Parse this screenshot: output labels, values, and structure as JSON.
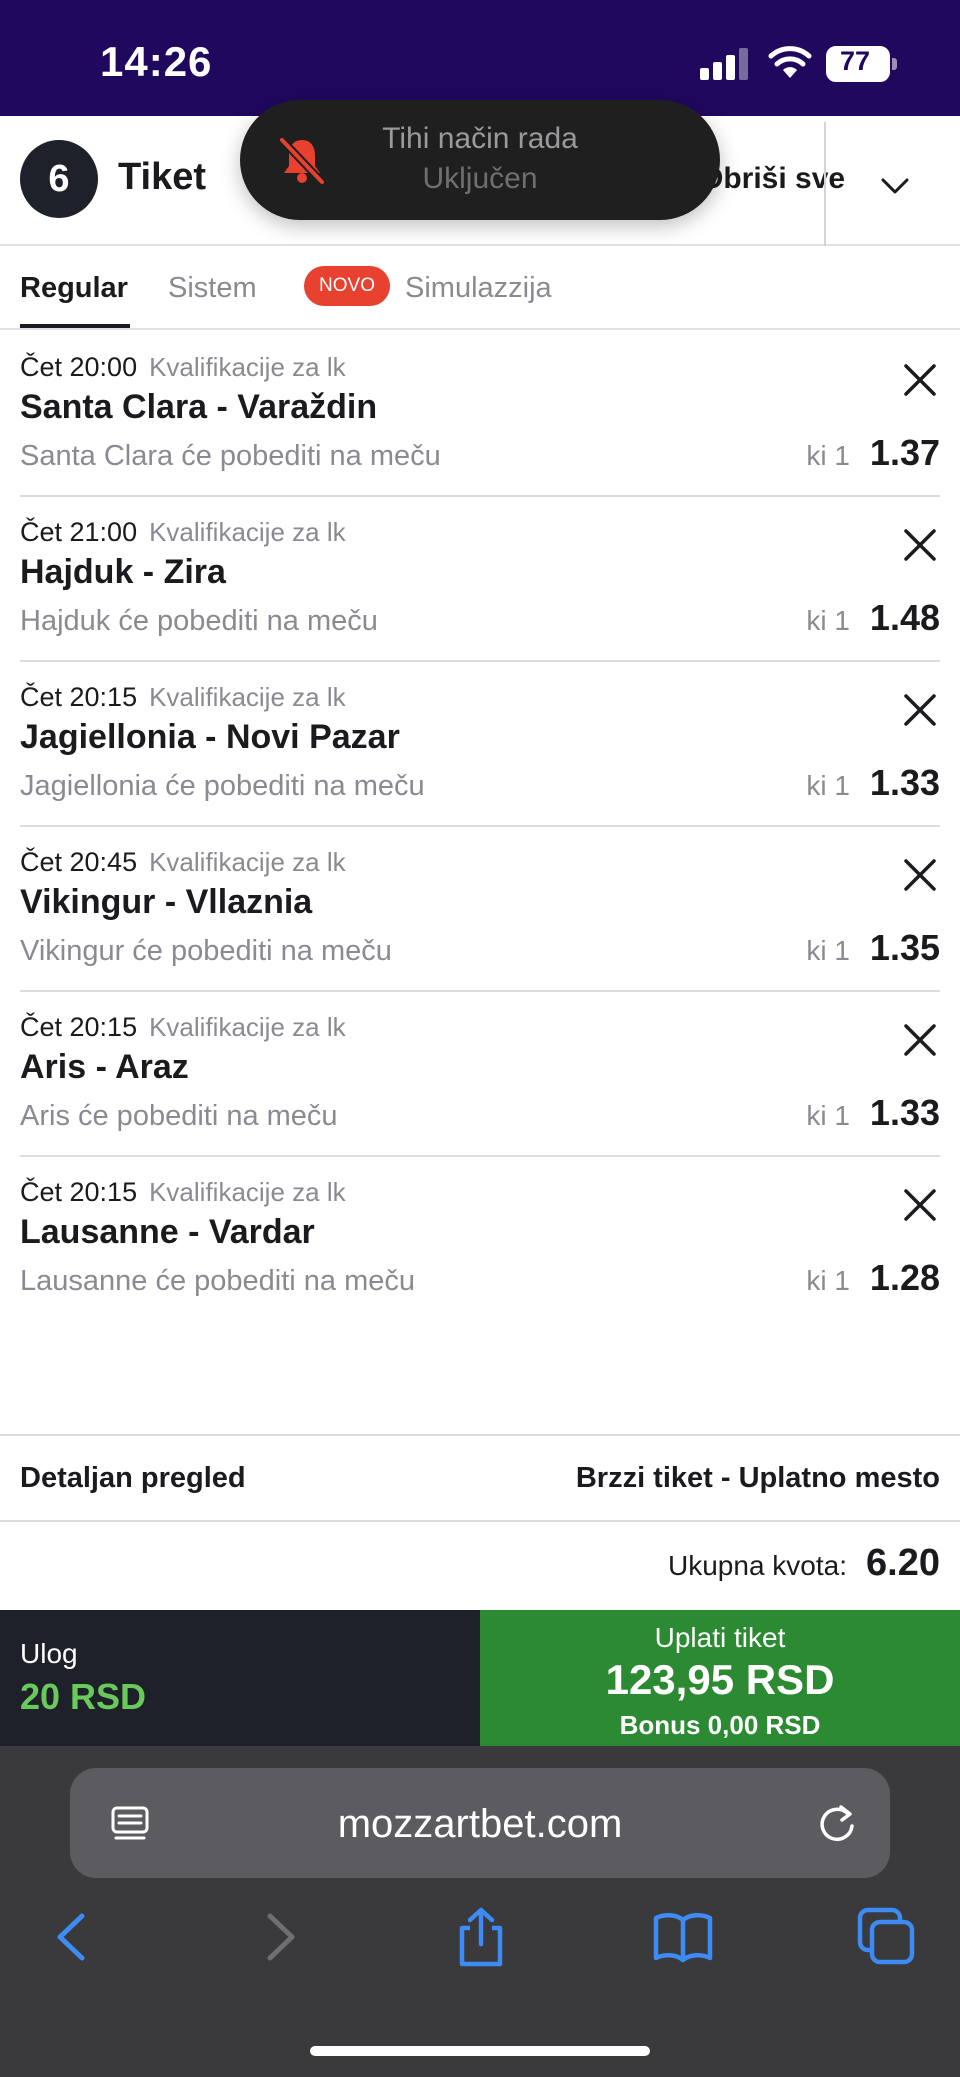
{
  "status_bar": {
    "time": "14:26",
    "battery": "77",
    "battery_level": 0.77
  },
  "header": {
    "count": "6",
    "title": "Tiket",
    "remove_all_label": "Obriši sve"
  },
  "toast": {
    "title": "Tihi način rada",
    "subtitle": "Uključen"
  },
  "tabs": [
    {
      "label": "Regular",
      "active": true
    },
    {
      "label": "Sistem",
      "active": false
    },
    {
      "label": "Simulazzija",
      "active": false,
      "badge": "NOVO"
    }
  ],
  "bets": [
    {
      "time": "Čet 20:00",
      "league": "Kvalifikacije za lk",
      "match": "Santa Clara - Varaždin",
      "pick": "Santa Clara će pobediti na meču",
      "market": "ki 1",
      "odd": "1.37"
    },
    {
      "time": "Čet 21:00",
      "league": "Kvalifikacije za lk",
      "match": "Hajduk - Zira",
      "pick": "Hajduk će pobediti na meču",
      "market": "ki 1",
      "odd": "1.48"
    },
    {
      "time": "Čet 20:15",
      "league": "Kvalifikacije za lk",
      "match": "Jagiellonia - Novi Pazar",
      "pick": "Jagiellonia će pobediti na meču",
      "market": "ki 1",
      "odd": "1.33"
    },
    {
      "time": "Čet 20:45",
      "league": "Kvalifikacije za lk",
      "match": "Vikingur - Vllaznia",
      "pick": "Vikingur će pobediti na meču",
      "market": "ki 1",
      "odd": "1.35"
    },
    {
      "time": "Čet 20:15",
      "league": "Kvalifikacije za lk",
      "match": "Aris - Araz",
      "pick": "Aris će pobediti na meču",
      "market": "ki 1",
      "odd": "1.33"
    },
    {
      "time": "Čet 20:15",
      "league": "Kvalifikacije za lk",
      "match": "Lausanne - Vardar",
      "pick": "Lausanne će pobediti na meču",
      "market": "ki 1",
      "odd": "1.28"
    }
  ],
  "summary": {
    "detail_label": "Detaljan pregled",
    "quick_ticket_label": "Brzzi tiket - Uplatno mesto",
    "total_label": "Ukupna kvota:",
    "total_value": "6.20"
  },
  "stake": {
    "label": "Ulog",
    "value": "20 RSD"
  },
  "pay": {
    "label": "Uplati tiket",
    "amount": "123,95 RSD",
    "bonus": "Bonus 0,00 RSD"
  },
  "browser": {
    "url": "mozzartbet.com"
  },
  "colors": {
    "status_bar_bg": "#20085e",
    "accent_badge": "#e8412f",
    "pay_button": "#2c8a32",
    "stake_value": "#69c95b",
    "ios_blue": "#3d8bf5"
  },
  "icons": [
    "signal-icon",
    "wifi-icon",
    "battery-icon",
    "bell-slash-icon",
    "chevron-down-icon",
    "close-icon",
    "reader-icon",
    "reload-icon",
    "back-icon",
    "forward-icon",
    "share-icon",
    "bookmarks-icon",
    "tabs-icon"
  ]
}
